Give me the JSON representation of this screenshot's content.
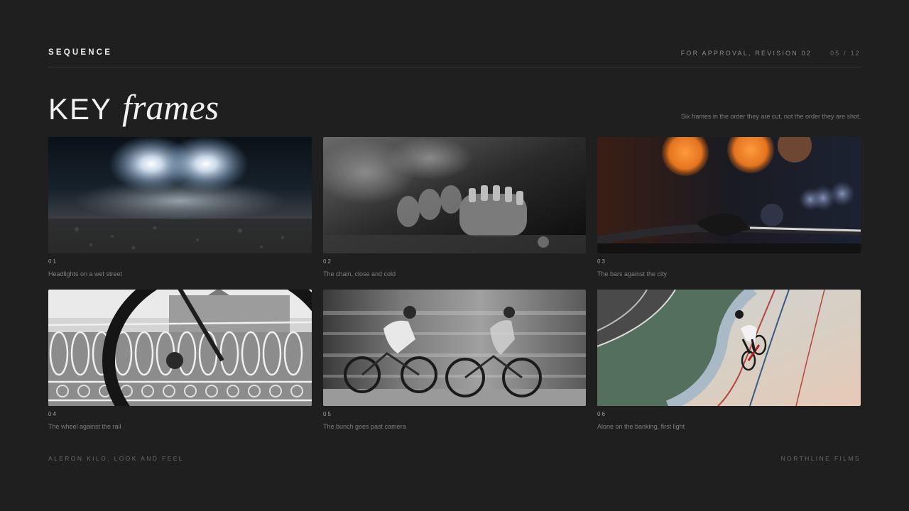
{
  "header": {
    "section_label": "SEQUENCE",
    "approval": "FOR APPROVAL, REVISION 02",
    "page": "05 / 12"
  },
  "title": {
    "plain": "KEY",
    "italic": "frames",
    "subtitle": "Six frames in the order they are cut, not the order they are shot."
  },
  "frames": [
    {
      "number": "01",
      "caption": "Headlights on a wet street"
    },
    {
      "number": "02",
      "caption": "The chain, close and cold"
    },
    {
      "number": "03",
      "caption": "The bars against the city"
    },
    {
      "number": "04",
      "caption": "The wheel against the rail"
    },
    {
      "number": "05",
      "caption": "The bunch goes past camera"
    },
    {
      "number": "06",
      "caption": "Alone on the banking, first light"
    }
  ],
  "footer": {
    "left": "ALERON KILO, LOOK AND FEEL",
    "right": "NORTHLINE FILMS"
  }
}
